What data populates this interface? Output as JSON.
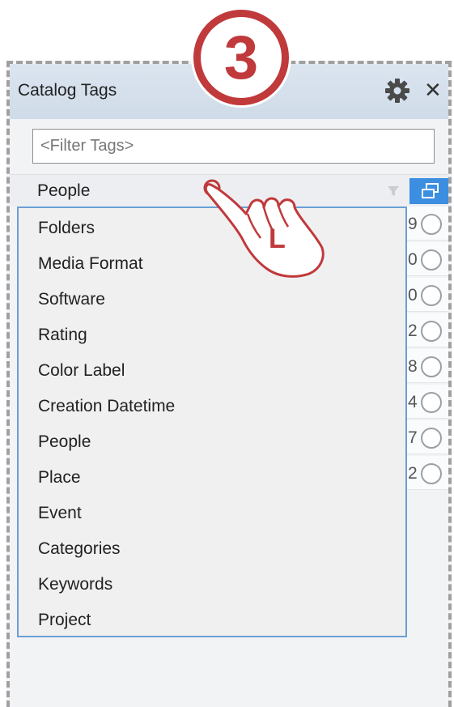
{
  "step_badge": {
    "number": "3"
  },
  "panel": {
    "title": "Catalog Tags",
    "filter_placeholder": "<Filter Tags>",
    "selected_category": "People"
  },
  "dropdown": {
    "options": [
      "Folders",
      "Media Format",
      "Software",
      "Rating",
      "Color Label",
      "Creation Datetime",
      "People",
      "Place",
      "Event",
      "Categories",
      "Keywords",
      "Project"
    ]
  },
  "counts": [
    "9",
    "0",
    "0",
    "2",
    "8",
    "4",
    "7",
    "2"
  ],
  "pointer": {
    "mouse_button_label": "L"
  },
  "colors": {
    "accent_red": "#c0393b",
    "header_blue": "#d6e1ee",
    "button_blue": "#3c8ee0",
    "dropdown_border": "#6a9fd4"
  }
}
